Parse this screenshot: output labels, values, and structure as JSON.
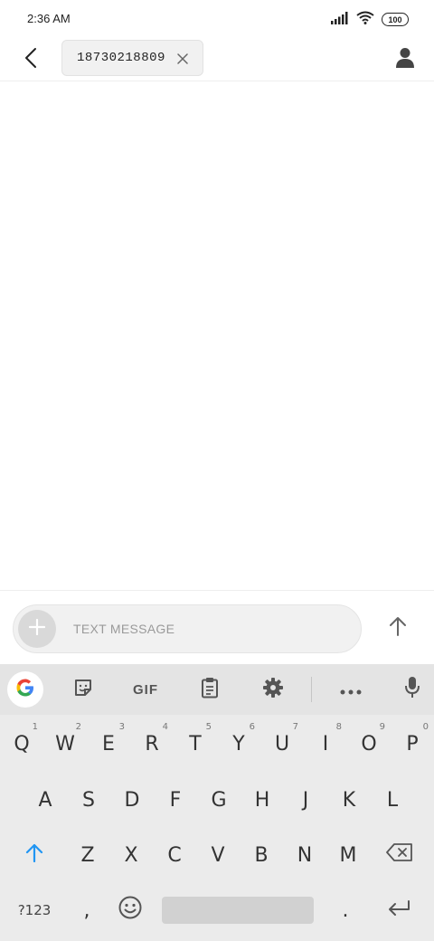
{
  "status": {
    "time": "2:36 AM",
    "battery": "100"
  },
  "header": {
    "recipient": "18730218809"
  },
  "compose": {
    "placeholder": "TEXT MESSAGE",
    "value": ""
  },
  "keyboard": {
    "toolbar": {
      "gif_label": "GIF"
    },
    "row1": [
      {
        "key": "Q",
        "hint": "1"
      },
      {
        "key": "W",
        "hint": "2"
      },
      {
        "key": "E",
        "hint": "3"
      },
      {
        "key": "R",
        "hint": "4"
      },
      {
        "key": "T",
        "hint": "5"
      },
      {
        "key": "Y",
        "hint": "6"
      },
      {
        "key": "U",
        "hint": "7"
      },
      {
        "key": "I",
        "hint": "8"
      },
      {
        "key": "O",
        "hint": "9"
      },
      {
        "key": "P",
        "hint": "0"
      }
    ],
    "row2": [
      "A",
      "S",
      "D",
      "F",
      "G",
      "H",
      "J",
      "K",
      "L"
    ],
    "row3": [
      "Z",
      "X",
      "C",
      "V",
      "B",
      "N",
      "M"
    ],
    "row4": {
      "symbols_label": "?123",
      "comma": ",",
      "period": "."
    }
  },
  "colors": {
    "accent_blue": "#2196f3",
    "keyboard_bg": "#ebebeb",
    "toolbar_bg": "#e4e4e4"
  }
}
